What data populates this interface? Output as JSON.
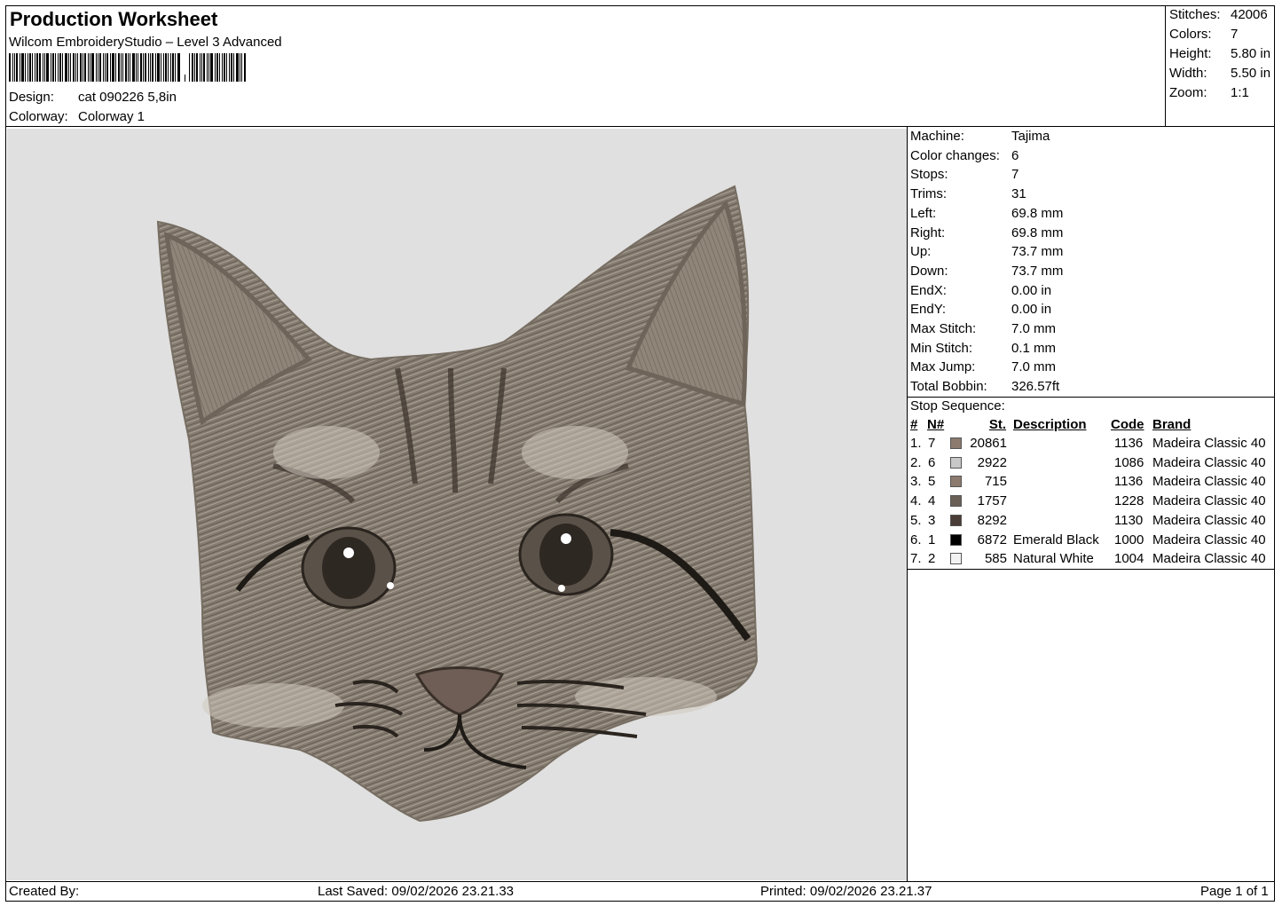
{
  "header": {
    "title": "Production Worksheet",
    "software": "Wilcom EmbroideryStudio – Level 3 Advanced",
    "design_label": "Design:",
    "design_value": "cat 090226 5,8in",
    "colorway_label": "Colorway:",
    "colorway_value": "Colorway 1"
  },
  "summary": [
    {
      "label": "Stitches:",
      "value": "42006"
    },
    {
      "label": "Colors:",
      "value": "7"
    },
    {
      "label": "Height:",
      "value": "5.80 in"
    },
    {
      "label": "Width:",
      "value": "5.50 in"
    },
    {
      "label": "Zoom:",
      "value": "1:1"
    }
  ],
  "machine_info": [
    {
      "label": "Machine:",
      "value": "Tajima"
    },
    {
      "label": "Color changes:",
      "value": "6"
    },
    {
      "label": "Stops:",
      "value": "7"
    },
    {
      "label": "Trims:",
      "value": "31"
    },
    {
      "label": "Left:",
      "value": "69.8 mm"
    },
    {
      "label": "Right:",
      "value": "69.8 mm"
    },
    {
      "label": "Up:",
      "value": "73.7 mm"
    },
    {
      "label": "Down:",
      "value": "73.7 mm"
    },
    {
      "label": "EndX:",
      "value": "0.00 in"
    },
    {
      "label": "EndY:",
      "value": "0.00 in"
    },
    {
      "label": "Max Stitch:",
      "value": "7.0 mm"
    },
    {
      "label": "Min Stitch:",
      "value": "0.1 mm"
    },
    {
      "label": "Max Jump:",
      "value": "7.0 mm"
    },
    {
      "label": "Total Bobbin:",
      "value": "326.57ft"
    }
  ],
  "stop_sequence": {
    "title": "Stop Sequence:",
    "columns": {
      "num": "#",
      "n": "N#",
      "st": "St.",
      "desc": "Description",
      "code": "Code",
      "brand": "Brand"
    },
    "rows": [
      {
        "num": "1.",
        "n": "7",
        "color": "#8c7a6e",
        "st": "20861",
        "desc": "",
        "code": "1136",
        "brand": "Madeira Classic 40"
      },
      {
        "num": "2.",
        "n": "6",
        "color": "#c8c8c8",
        "st": "2922",
        "desc": "",
        "code": "1086",
        "brand": "Madeira Classic 40"
      },
      {
        "num": "3.",
        "n": "5",
        "color": "#8c7a6e",
        "st": "715",
        "desc": "",
        "code": "1136",
        "brand": "Madeira Classic 40"
      },
      {
        "num": "4.",
        "n": "4",
        "color": "#6a6058",
        "st": "1757",
        "desc": "",
        "code": "1228",
        "brand": "Madeira Classic 40"
      },
      {
        "num": "5.",
        "n": "3",
        "color": "#4a3c36",
        "st": "8292",
        "desc": "",
        "code": "1130",
        "brand": "Madeira Classic 40"
      },
      {
        "num": "6.",
        "n": "1",
        "color": "#000000",
        "st": "6872",
        "desc": "Emerald Black",
        "code": "1000",
        "brand": "Madeira Classic 40"
      },
      {
        "num": "7.",
        "n": "2",
        "color": "#f2f2f2",
        "st": "585",
        "desc": "Natural White",
        "code": "1004",
        "brand": "Madeira Classic 40"
      }
    ]
  },
  "footer": {
    "created_by": "Created By:",
    "last_saved": "Last Saved: 09/02/2026 23.21.33",
    "printed": "Printed: 09/02/2026 23.21.37",
    "page": "Page 1 of 1"
  },
  "colors": {
    "preview_bg": "#e0e0e0",
    "fur": "#8a8176",
    "fur_dark": "#4a4038",
    "fur_light": "#cfc9bd"
  }
}
